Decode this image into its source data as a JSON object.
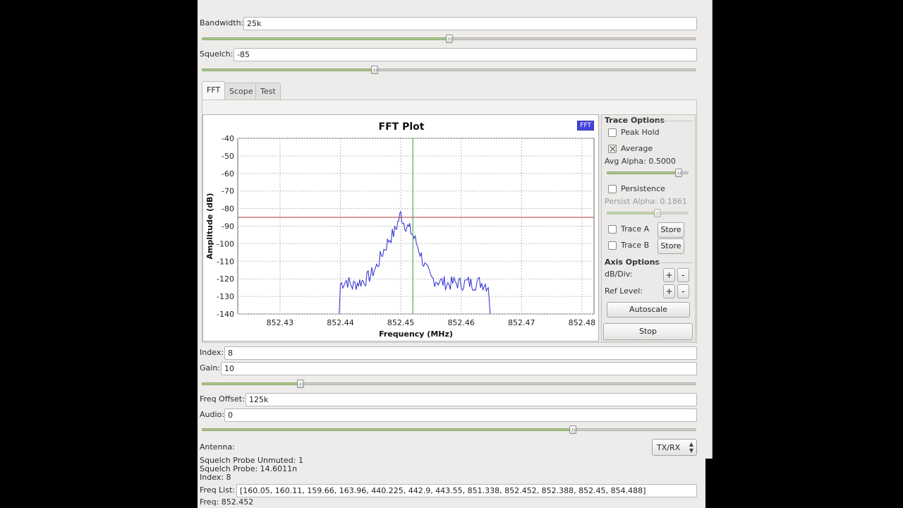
{
  "controls": {
    "bandwidth": {
      "label": "Bandwidth:",
      "value": "25k",
      "slider_fraction": 0.5
    },
    "squelch": {
      "label": "Squelch:",
      "value": "-85",
      "slider_fraction": 0.35
    },
    "index": {
      "label": "Index:",
      "value": "8"
    },
    "gain": {
      "label": "Gain:",
      "value": "10",
      "slider_fraction": 0.2
    },
    "freq_offset": {
      "label": "Freq Offset:",
      "value": "125k"
    },
    "audio": {
      "label": "Audio:",
      "value": "0",
      "slider_fraction": 0.75
    }
  },
  "tabs": [
    {
      "label": "FFT",
      "active": true
    },
    {
      "label": "Scope",
      "active": false
    },
    {
      "label": "Test",
      "active": false
    }
  ],
  "plot": {
    "badge": "FFT",
    "background": "#ffffff",
    "grid_color": "#bdbdbd",
    "trace_color": "#2b2bd0",
    "marker_v_color": "#2fa02f",
    "marker_h_color": "#b33b3b"
  },
  "chart_data": {
    "type": "line",
    "title": "FFT Plot",
    "xlabel": "Frequency (MHz)",
    "ylabel": "Amplitude (dB)",
    "xlim": [
      852.423,
      852.482
    ],
    "ylim": [
      -140,
      -40
    ],
    "x_ticks": [
      852.43,
      852.44,
      852.45,
      852.46,
      852.47,
      852.48
    ],
    "x_tick_labels": [
      "852.43",
      "852.44",
      "852.45",
      "852.46",
      "852.47",
      "852.48"
    ],
    "y_ticks": [
      -40,
      -50,
      -60,
      -70,
      -80,
      -90,
      -100,
      -110,
      -120,
      -130,
      -140
    ],
    "y_tick_labels": [
      "-40",
      "-50",
      "-60",
      "-70",
      "-80",
      "-90",
      "-100",
      "-110",
      "-120",
      "-130",
      "-140"
    ],
    "grid": true,
    "markers": {
      "vertical_x": 852.452,
      "horizontal_y": -85
    },
    "series": [
      {
        "x": [
          852.4398,
          852.44,
          852.441,
          852.442,
          852.443,
          852.444,
          852.445,
          852.446,
          852.447,
          852.448,
          852.449,
          852.4495,
          852.45,
          852.4505,
          852.451,
          852.4515,
          852.452,
          852.453,
          852.454,
          852.455,
          852.456,
          852.457,
          852.458,
          852.459,
          852.46,
          852.461,
          852.462,
          852.463,
          852.464,
          852.4645,
          852.4648
        ],
        "y": [
          -140,
          -123,
          -121,
          -124,
          -122,
          -121,
          -118,
          -113,
          -105,
          -98,
          -93,
          -88,
          -83,
          -88,
          -90,
          -92,
          -95,
          -103,
          -113,
          -120,
          -121,
          -122,
          -123,
          -122,
          -123,
          -122,
          -123,
          -122,
          -123,
          -125,
          -140
        ]
      }
    ]
  },
  "trace_options": {
    "title": "Trace Options",
    "peak_hold": {
      "label": "Peak Hold",
      "checked": false
    },
    "average": {
      "label": "Average",
      "checked": true
    },
    "avg_alpha_label": "Avg Alpha: 0.5000",
    "avg_alpha_fraction": 0.88,
    "persistence": {
      "label": "Persistence",
      "checked": false
    },
    "persist_alpha_label": "Persist Alpha: 0.1861",
    "persist_alpha_fraction": 0.62,
    "trace_a": {
      "label": "Trace A",
      "checked": false,
      "button": "Store"
    },
    "trace_b": {
      "label": "Trace B",
      "checked": false,
      "button": "Store"
    }
  },
  "axis_options": {
    "title": "Axis Options",
    "db_div_label": "dB/Div:",
    "ref_level_label": "Ref Level:",
    "plus": "+",
    "minus": "-",
    "autoscale": "Autoscale"
  },
  "stop_button": "Stop",
  "antenna": {
    "label": "Antenna:",
    "value": "TX/RX"
  },
  "status": {
    "squelch_probe_unmuted": "Squelch Probe Unmuted: 1",
    "squelch_probe": "Squelch Probe: 14.6011n",
    "index": "Index: 8",
    "freq_list_label": "Freq List:",
    "freq_list_value": "[160.05, 160.11, 159.66, 163.96, 440.225, 442.9, 443.55, 851.338, 852.452, 852.388, 852.45, 854.488]",
    "freq": "Freq: 852.452"
  }
}
